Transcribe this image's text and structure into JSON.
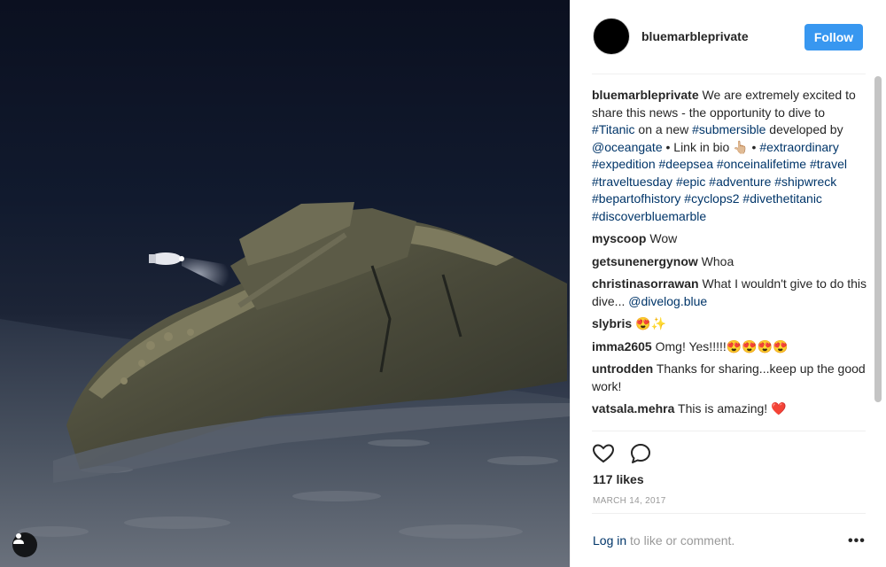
{
  "post": {
    "username": "bluemarbleprivate",
    "follow_label": "Follow",
    "caption": {
      "user": "bluemarbleprivate",
      "text_1": " We are extremely excited to share this news - the opportunity to dive to ",
      "tag_titanic": "#Titanic",
      "text_2": " on a new ",
      "tag_submersible": "#submersible",
      "text_3": " developed by ",
      "mention_oceangate": "@oceangate",
      "text_4": " • Link in bio 👆🏼 • ",
      "tags_rest": "#extraordinary #expedition #deepsea #onceinalifetime #travel #traveltuesday #epic #adventure #shipwreck #bepartofhistory #cyclops2 #divethetitanic #discoverbluemarble"
    },
    "comments": [
      {
        "user": "myscoop",
        "text": " Wow"
      },
      {
        "user": "getsunenergynow",
        "text": " Whoa"
      },
      {
        "user": "christinasorrawan",
        "text": " What I wouldn't give to do this dive... ",
        "mention": "@divelog.blue"
      },
      {
        "user": "slybris",
        "text": " 😍✨"
      },
      {
        "user": "imma2605",
        "text": " Omg! Yes!!!!!😍😍😍😍"
      },
      {
        "user": "untrodden",
        "text": " Thanks for sharing...keep up the good work!"
      },
      {
        "user": "vatsala.mehra",
        "text": " This is amazing! ❤️"
      }
    ],
    "likes": "117 likes",
    "date": "MARCH 14, 2017",
    "login_link": "Log in",
    "login_rest": " to like or comment.",
    "more_label": "•••"
  },
  "icons": {
    "like": "heart-outline-icon",
    "comment": "speech-bubble-icon",
    "user_tag": "person-icon",
    "more": "ellipsis-icon"
  },
  "colors": {
    "follow_bg": "#3897f0",
    "link": "#003569",
    "muted": "#999999",
    "border": "#efefef"
  }
}
